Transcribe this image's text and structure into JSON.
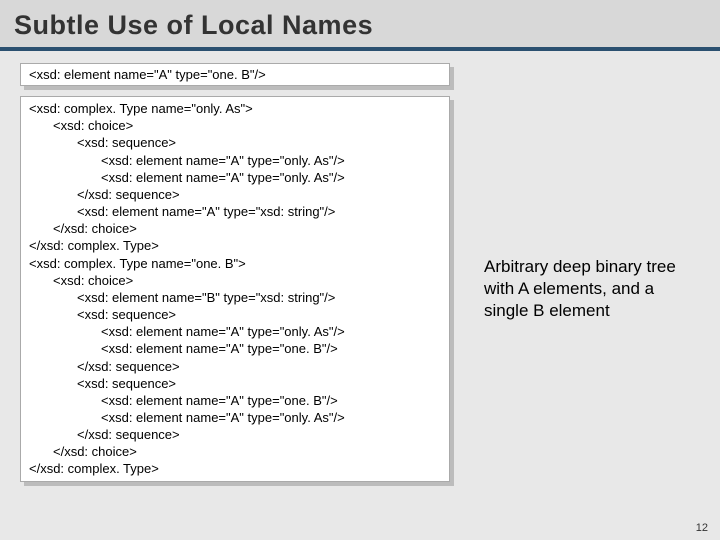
{
  "title": "Subtle Use of Local Names",
  "box1": {
    "line1": "<xsd: element name=\"A\" type=\"one. B\"/>"
  },
  "box2": {
    "l1": "<xsd: complex. Type name=\"only. As\">",
    "l2": "<xsd: choice>",
    "l3": "<xsd: sequence>",
    "l4": "<xsd: element name=\"A\" type=\"only. As\"/>",
    "l5": "<xsd: element name=\"A\" type=\"only. As\"/>",
    "l6": "</xsd: sequence>",
    "l7": "<xsd: element name=\"A\" type=\"xsd: string\"/>",
    "l8": "</xsd: choice>",
    "l9": "</xsd: complex. Type>",
    "l10": "",
    "l11": "<xsd: complex. Type name=\"one. B\">",
    "l12": "<xsd: choice>",
    "l13": "<xsd: element name=\"B\" type=\"xsd: string\"/>",
    "l14": "<xsd: sequence>",
    "l15": "<xsd: element name=\"A\" type=\"only. As\"/>",
    "l16": "<xsd: element name=\"A\" type=\"one. B\"/>",
    "l17": "</xsd: sequence>",
    "l18": "<xsd: sequence>",
    "l19": "<xsd: element name=\"A\" type=\"one. B\"/>",
    "l20": "<xsd: element name=\"A\" type=\"only. As\"/>",
    "l21": "</xsd: sequence>",
    "l22": "</xsd: choice>",
    "l23": "</xsd: complex. Type>"
  },
  "annotation": "Arbitrary deep binary tree with A elements, and a single B element",
  "pageNumber": "12"
}
